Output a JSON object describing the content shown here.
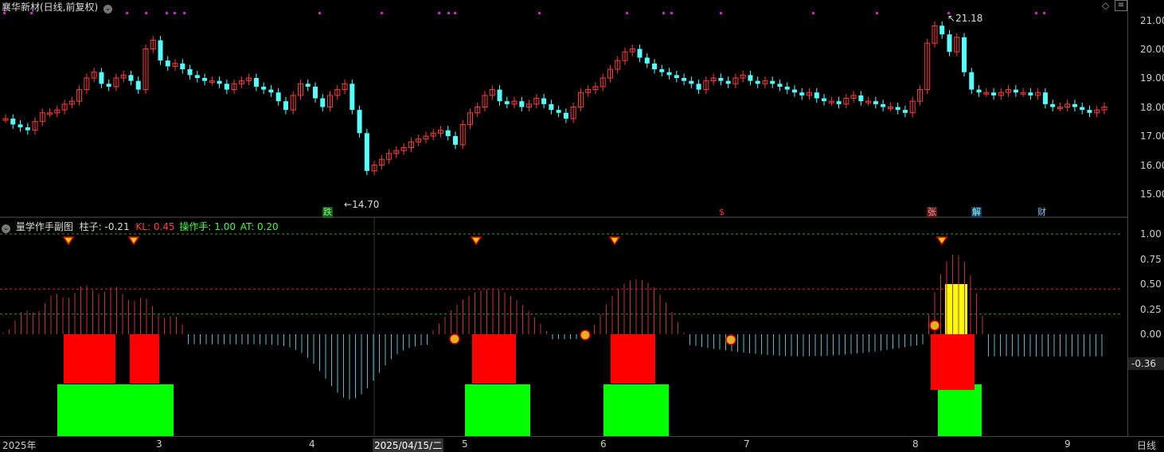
{
  "header": {
    "title": "襄华新材(日线,前复权)",
    "diamond_icon": "◇",
    "menu_icon": "≡"
  },
  "main_chart": {
    "y_ticks": [
      "21.00",
      "20.00",
      "19.00",
      "18.00",
      "17.00",
      "16.00",
      "15.00"
    ],
    "high_label": "21.18",
    "low_label": "14.70",
    "markers": [
      "跌",
      "$",
      "张",
      "解",
      "财"
    ]
  },
  "sub_chart": {
    "title": "量学作手副图",
    "legend_zhuzi": "柱子: -0.21",
    "legend_kl": "KL: 0.45",
    "legend_czs": "操作手: 1.00",
    "legend_at": "AT: 0.20",
    "y_ticks": [
      "1.00",
      "0.75",
      "0.50",
      "0.25",
      "0.00"
    ],
    "current_value": "-0.36"
  },
  "x_axis": {
    "labels": [
      "2025年",
      "3",
      "4",
      "2025/04/15/二",
      "5",
      "6",
      "7",
      "8",
      "9"
    ],
    "period": "日线"
  },
  "colors": {
    "up": "#ff3b3b",
    "down": "#54ffff",
    "green_block": "#00ff00",
    "red_block": "#ff0000",
    "yellow_block": "#ffff00",
    "dashed_green": "#2f9e2f",
    "dashed_red": "#b03030"
  }
}
